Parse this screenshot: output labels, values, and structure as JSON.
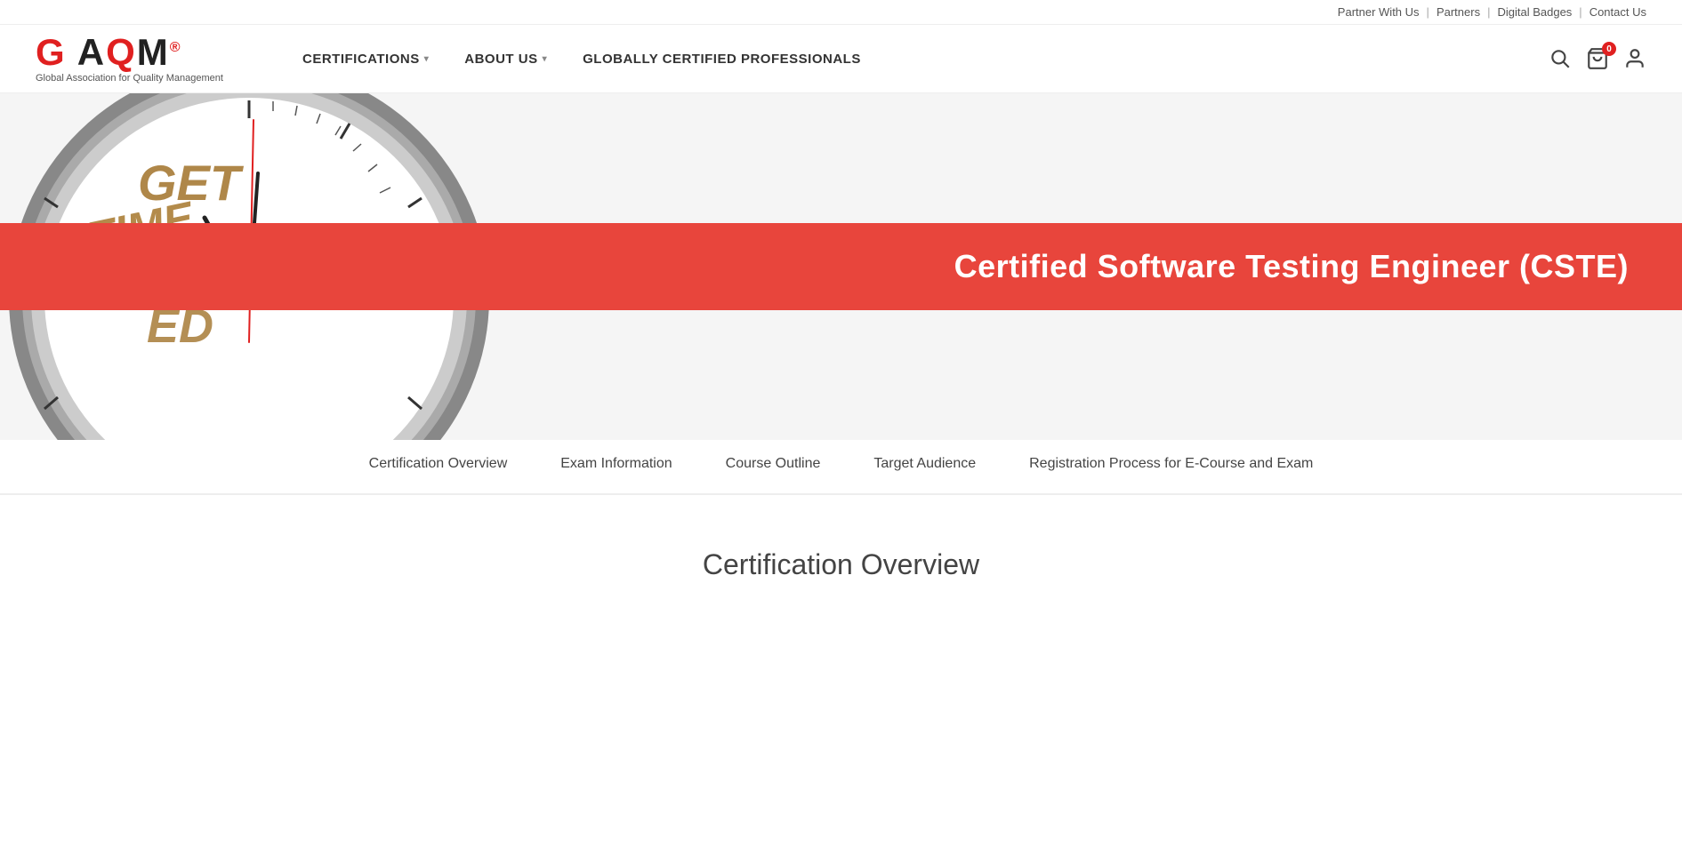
{
  "topbar": {
    "partner_with_us": "Partner With Us",
    "partners": "Partners",
    "digital_badges": "Digital Badges",
    "contact_us": "Contact Us"
  },
  "header": {
    "logo": {
      "text": "GAQM",
      "tagline": "Global Association for Quality Management",
      "registered_symbol": "®"
    },
    "nav": [
      {
        "label": "CERTIFICATIONS",
        "has_dropdown": true
      },
      {
        "label": "ABOUT US",
        "has_dropdown": true
      },
      {
        "label": "GLOBALLY CERTIFIED PROFESSIONALS",
        "has_dropdown": false
      }
    ],
    "cart_count": "0"
  },
  "hero": {
    "title": "Certified Software Testing Engineer (CSTE)"
  },
  "tabs": [
    {
      "label": "Certification Overview",
      "active": false
    },
    {
      "label": "Exam Information",
      "active": false
    },
    {
      "label": "Course Outline",
      "active": false
    },
    {
      "label": "Target Audience",
      "active": false
    },
    {
      "label": "Registration Process for E-Course and Exam",
      "active": false
    }
  ],
  "content": {
    "section_title": "Certification Overview"
  }
}
